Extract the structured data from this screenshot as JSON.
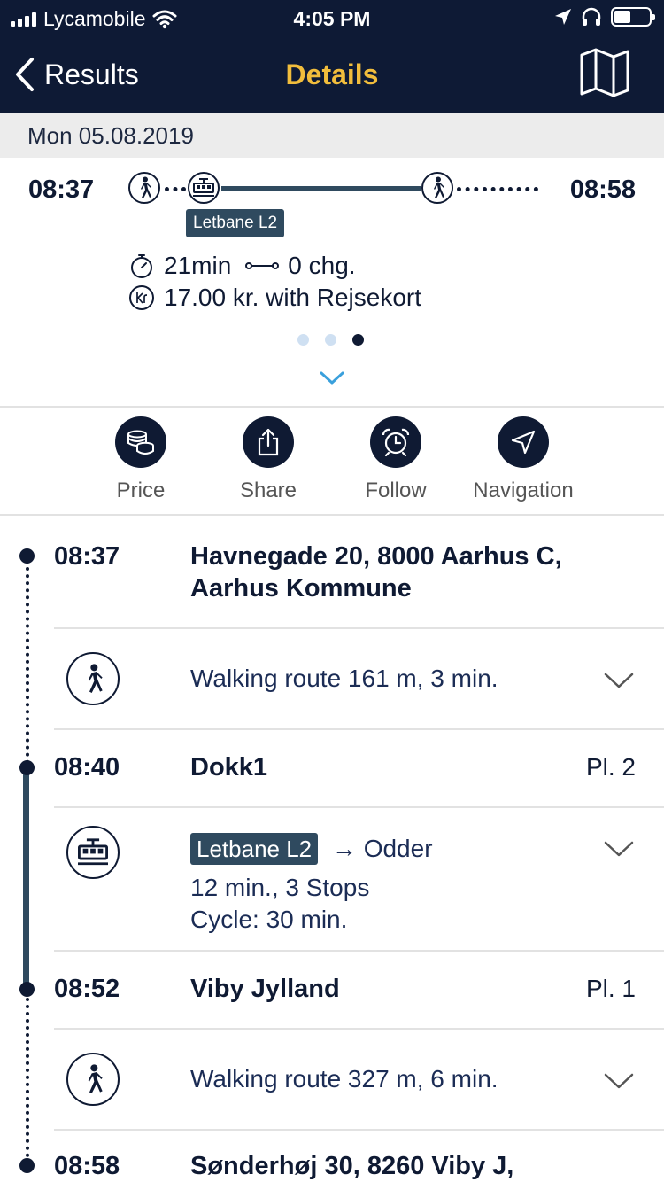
{
  "status_bar": {
    "carrier": "Lycamobile",
    "time": "4:05 PM"
  },
  "nav": {
    "back_label": "Results",
    "title": "Details"
  },
  "date": "Mon 05.08.2019",
  "summary": {
    "departure": "08:37",
    "arrival": "08:58",
    "line": "Letbane L2",
    "duration": "21min",
    "changes": "0 chg.",
    "price": "17.00 kr. with Rejsekort",
    "page_count": 3,
    "active_page": 3
  },
  "actions": [
    {
      "label": "Price",
      "icon": "coins-icon"
    },
    {
      "label": "Share",
      "icon": "share-icon"
    },
    {
      "label": "Follow",
      "icon": "alarm-clock-icon"
    },
    {
      "label": "Navigation",
      "icon": "navigation-arrow-icon"
    }
  ],
  "itinerary": {
    "stops": [
      {
        "time": "08:37",
        "name": "Havnegade 20, 8000 Aarhus C, Aarhus Kommune",
        "platform": ""
      },
      {
        "time": "08:40",
        "name": "Dokk1",
        "platform": "Pl. 2"
      },
      {
        "time": "08:52",
        "name": "Viby Jylland",
        "platform": "Pl. 1"
      },
      {
        "time": "08:58",
        "name": "Sønderhøj 30, 8260 Viby J,",
        "platform": ""
      }
    ],
    "legs": [
      {
        "type": "walk",
        "text": "Walking route 161 m, 3 min."
      },
      {
        "type": "tram",
        "line": "Letbane L2",
        "direction": "→ Odder",
        "details": "12 min., 3 Stops",
        "cycle": "Cycle: 30 min."
      },
      {
        "type": "walk",
        "text": "Walking route 327 m, 6 min."
      }
    ]
  },
  "colors": {
    "header": "#0e1a35",
    "accent": "#f1bd3c",
    "line": "#2f4a5f",
    "text": "#0f1a33",
    "link": "#1b2c55",
    "pager_inactive": "#cfe0f2"
  }
}
